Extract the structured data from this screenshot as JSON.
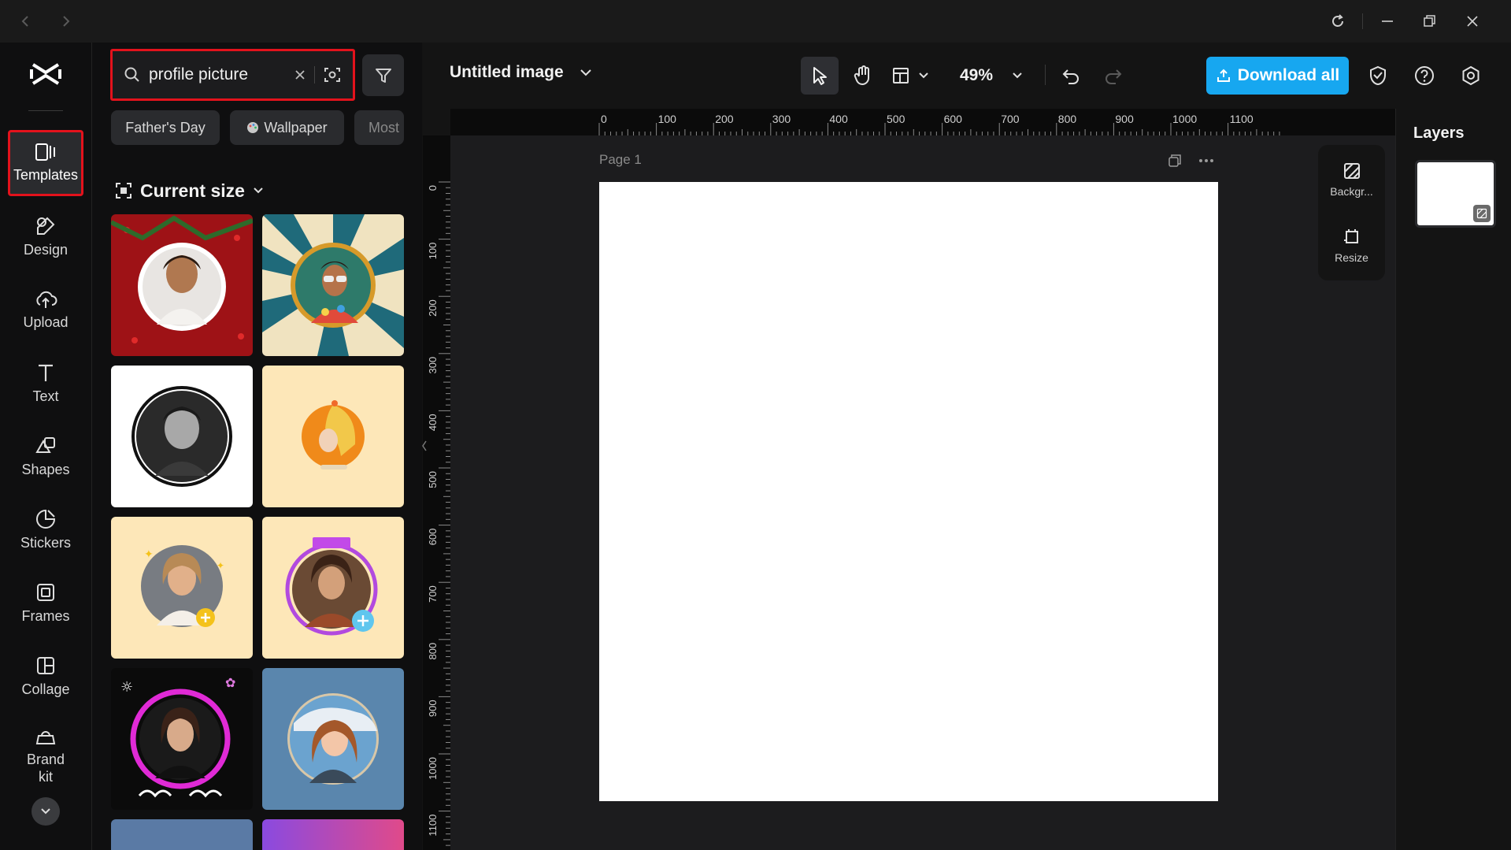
{
  "window": {
    "back_icon": "chevron-left-icon",
    "forward_icon": "chevron-right-icon"
  },
  "sidebar": {
    "items": [
      {
        "label": "Templates",
        "icon": "templates-icon",
        "active": true
      },
      {
        "label": "Design",
        "icon": "design-icon"
      },
      {
        "label": "Upload",
        "icon": "upload-icon"
      },
      {
        "label": "Text",
        "icon": "text-icon"
      },
      {
        "label": "Shapes",
        "icon": "shapes-icon"
      },
      {
        "label": "Stickers",
        "icon": "stickers-icon"
      },
      {
        "label": "Frames",
        "icon": "frames-icon"
      },
      {
        "label": "Collage",
        "icon": "collage-icon"
      },
      {
        "label": "Brand kit",
        "icon": "brand-kit-icon"
      }
    ]
  },
  "search": {
    "value": "profile picture"
  },
  "chips": [
    "Father's Day",
    "Wallpaper",
    "Most"
  ],
  "panel": {
    "size_label": "Current size"
  },
  "document": {
    "title": "Untitled image"
  },
  "toolbar": {
    "zoom": "49%",
    "download_label": "Download all"
  },
  "canvas": {
    "page_label": "Page 1"
  },
  "ruler": {
    "h_ticks": [
      "0",
      "100",
      "200",
      "300",
      "400",
      "500",
      "600",
      "700",
      "800",
      "900",
      "1000",
      "1100"
    ],
    "v_ticks": [
      "0",
      "100",
      "200",
      "300",
      "400",
      "500",
      "600",
      "700",
      "800",
      "900",
      "1000",
      "1100"
    ]
  },
  "tools": [
    {
      "label": "Backgr...",
      "icon": "background-icon"
    },
    {
      "label": "Resize",
      "icon": "resize-icon"
    }
  ],
  "layers": {
    "title": "Layers"
  },
  "colors": {
    "accent": "#17a7f0",
    "highlight": "#e3121c",
    "page": "#ffffff"
  }
}
